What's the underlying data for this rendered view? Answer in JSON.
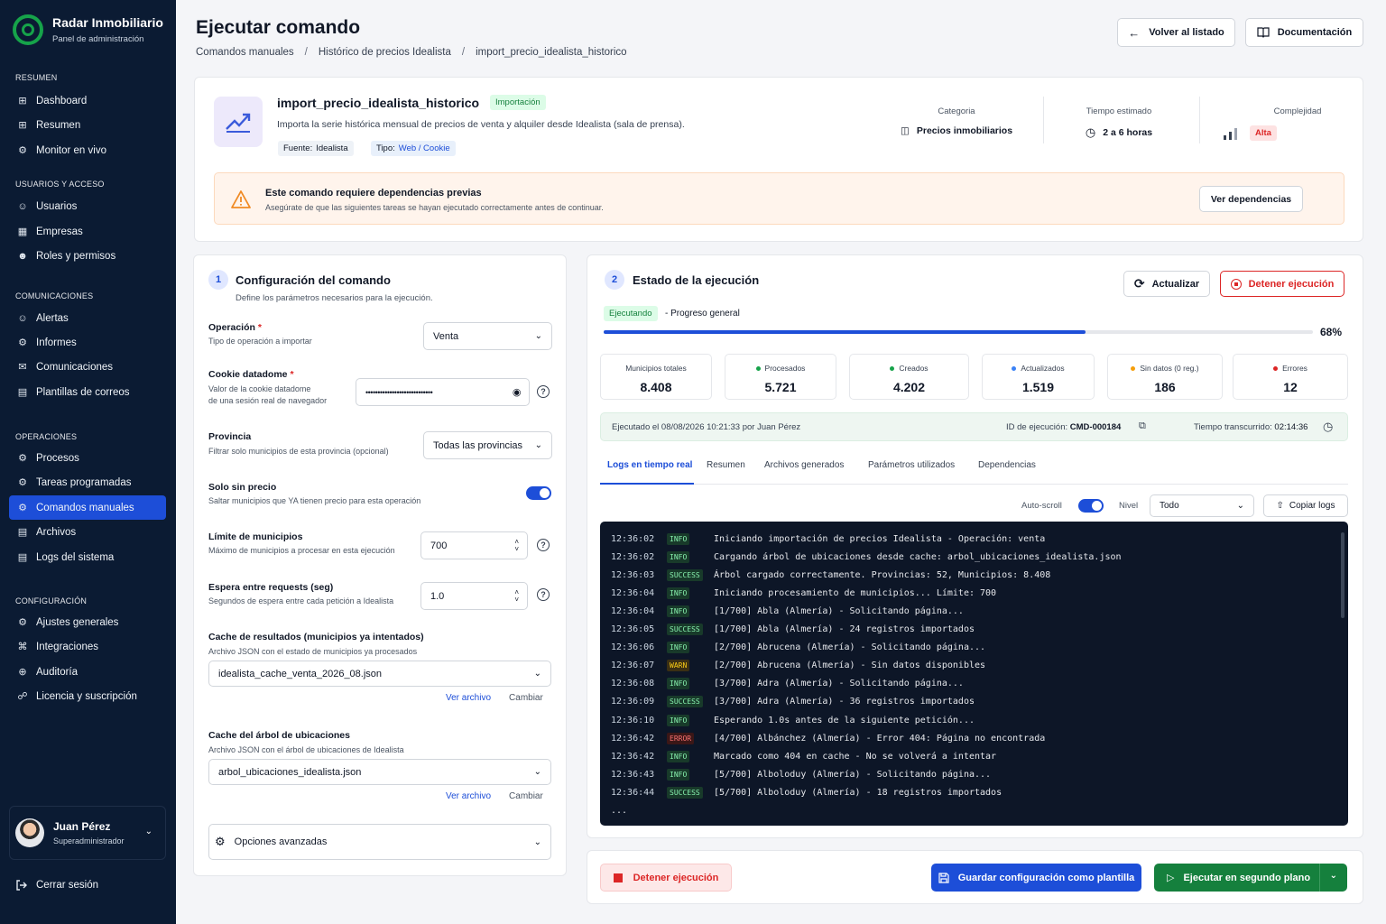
{
  "brand": {
    "title": "Radar Inmobiliario",
    "subtitle": "Panel de administración"
  },
  "nav": {
    "sections": [
      {
        "label": "RESUMEN",
        "items": [
          {
            "label": "Dashboard",
            "icon": "grid-icon"
          },
          {
            "label": "Resumen",
            "icon": "grid-icon"
          },
          {
            "label": "Monitor en vivo",
            "icon": "gear-icon"
          }
        ]
      },
      {
        "label": "USUARIOS Y ACCESO",
        "items": [
          {
            "label": "Usuarios",
            "icon": "user-icon"
          },
          {
            "label": "Empresas",
            "icon": "building-icon"
          },
          {
            "label": "Roles y permisos",
            "icon": "users-icon"
          }
        ]
      },
      {
        "label": "COMUNICACIONES",
        "items": [
          {
            "label": "Alertas",
            "icon": "user-icon"
          },
          {
            "label": "Informes",
            "icon": "gear-icon"
          },
          {
            "label": "Comunicaciones",
            "icon": "chat-icon"
          },
          {
            "label": "Plantillas de correos",
            "icon": "document-icon"
          }
        ]
      },
      {
        "label": "OPERACIONES",
        "items": [
          {
            "label": "Procesos",
            "icon": "gear-icon"
          },
          {
            "label": "Tareas programadas",
            "icon": "gear-icon"
          },
          {
            "label": "Comandos manuales",
            "icon": "gear-icon",
            "active": true
          },
          {
            "label": "Archivos",
            "icon": "document-icon"
          },
          {
            "label": "Logs del sistema",
            "icon": "document-icon"
          }
        ]
      },
      {
        "label": "CONFIGURACIÓN",
        "items": [
          {
            "label": "Ajustes generales",
            "icon": "gear-icon"
          },
          {
            "label": "Integraciones",
            "icon": "command-icon"
          },
          {
            "label": "Auditoría",
            "icon": "plus-circle-icon"
          },
          {
            "label": "Licencia y suscripción",
            "icon": "link-icon"
          }
        ]
      }
    ]
  },
  "user": {
    "name": "Juan Pérez",
    "role": "Superadministrador",
    "logout": "Cerrar sesión"
  },
  "header": {
    "title": "Ejecutar comando",
    "breadcrumb": [
      "Comandos manuales",
      "Histórico de precios Idealista",
      "import_precio_idealista_historico"
    ],
    "back": "Volver al listado",
    "docs": "Documentación"
  },
  "command": {
    "name": "import_precio_idealista_historico",
    "badge": "Importación",
    "description": "Importa la serie histórica mensual de precios de venta y alquiler desde Idealista (sala de prensa).",
    "source_label": "Fuente:",
    "source_value": "Idealista",
    "type_label": "Tipo:",
    "type_value": "Web / Cookie",
    "category_label": "Categoria",
    "category_value": "Precios inmobiliarios",
    "time_label": "Tiempo estimado",
    "time_value": "2 a 6 horas",
    "complexity_label": "Complejidad",
    "complexity_value": "Alta"
  },
  "alert": {
    "title": "Este comando requiere dependencias previas",
    "text": "Asegúrate de que las siguientes tareas se hayan ejecutado correctamente antes de continuar.",
    "button": "Ver dependencias"
  },
  "config": {
    "number": "1",
    "title": "Configuración del comando",
    "subtitle": "Define los parámetros necesarios para la ejecución.",
    "operation": {
      "label": "Operación",
      "help": "Tipo de operación a importar",
      "value": "Venta"
    },
    "cookie": {
      "label": "Cookie datadome",
      "help1": "Valor de la cookie datadome",
      "help2": "de una sesión real de navegador",
      "value": "••••••••••••••••••••••••••••"
    },
    "province": {
      "label": "Provincia",
      "help": "Filtrar solo municipios de esta provincia (opcional)",
      "value": "Todas las provincias"
    },
    "noprice": {
      "label": "Solo sin precio",
      "help": "Saltar municipios que YA tienen precio para esta operación"
    },
    "limit": {
      "label": "Límite de municipios",
      "help": "Máximo de municipios a procesar en esta ejecución",
      "value": "700"
    },
    "wait": {
      "label": "Espera entre requests (seg)",
      "help": "Segundos de espera entre cada petición a Idealista",
      "value": "1.0"
    },
    "cache": {
      "label": "Cache de resultados (municipios ya intentados)",
      "help": "Archivo JSON con el estado de municipios ya procesados",
      "value": "idealista_cache_venta_2026_08.json",
      "view": "Ver archivo",
      "change": "Cambiar"
    },
    "tree": {
      "label": "Cache del árbol de ubicaciones",
      "help": "Archivo JSON con el árbol de ubicaciones de Idealista",
      "value": "arbol_ubicaciones_idealista.json",
      "view": "Ver archivo",
      "change": "Cambiar"
    },
    "advanced": "Opciones avanzadas"
  },
  "status": {
    "number": "2",
    "title": "Estado de la ejecución",
    "refresh": "Actualizar",
    "stop": "Detener ejecución",
    "state": "Ejecutando",
    "progress_label": "Progreso general",
    "progress": 0.68,
    "progress_text": "68%",
    "stats": [
      {
        "label": "Municipios totales",
        "value": "8.408",
        "dot": ""
      },
      {
        "label": "Procesados",
        "value": "5.721",
        "dot": "#16a34a"
      },
      {
        "label": "Creados",
        "value": "4.202",
        "dot": "#16a34a"
      },
      {
        "label": "Actualizados",
        "value": "1.519",
        "dot": "#3b82f6"
      },
      {
        "label": "Sin datos (0 reg.)",
        "value": "186",
        "dot": "#f59e0b"
      },
      {
        "label": "Errores",
        "value": "12",
        "dot": "#dc2626"
      }
    ],
    "executed": "Ejecutado el 08/08/2026 10:21:33 por Juan Pérez",
    "exec_id_label": "ID de ejecución:",
    "exec_id": "CMD-000184",
    "elapsed_label": "Tiempo transcurrido:",
    "elapsed": "02:14:36",
    "tabs": [
      "Logs en tiempo real",
      "Resumen",
      "Archivos generados",
      "Parámetros utilizados",
      "Dependencias"
    ],
    "autoscroll": "Auto-scroll",
    "level_label": "Nivel",
    "level_value": "Todo",
    "copy": "Copiar logs",
    "logs": [
      {
        "t": "12:36:02",
        "l": "INFO",
        "m": "Iniciando importación de precios Idealista - Operación: venta"
      },
      {
        "t": "12:36:02",
        "l": "INFO",
        "m": "Cargando árbol de ubicaciones desde cache: arbol_ubicaciones_idealista.json"
      },
      {
        "t": "12:36:03",
        "l": "SUCCESS",
        "m": "Árbol cargado correctamente. Provincias: 52, Municipios: 8.408"
      },
      {
        "t": "12:36:04",
        "l": "INFO",
        "m": "Iniciando procesamiento de municipios... Límite: 700"
      },
      {
        "t": "12:36:04",
        "l": "INFO",
        "m": "[1/700] Abla (Almería) - Solicitando página..."
      },
      {
        "t": "12:36:05",
        "l": "SUCCESS",
        "m": "[1/700] Abla (Almería) - 24 registros importados"
      },
      {
        "t": "12:36:06",
        "l": "INFO",
        "m": "[2/700] Abrucena (Almería) - Solicitando página..."
      },
      {
        "t": "12:36:07",
        "l": "WARN",
        "m": "[2/700] Abrucena (Almería) - Sin datos disponibles"
      },
      {
        "t": "12:36:08",
        "l": "INFO",
        "m": "[3/700] Adra (Almería) - Solicitando página..."
      },
      {
        "t": "12:36:09",
        "l": "SUCCESS",
        "m": "[3/700] Adra (Almería) - 36 registros importados"
      },
      {
        "t": "12:36:10",
        "l": "INFO",
        "m": "Esperando 1.0s antes de la siguiente petición..."
      },
      {
        "t": "12:36:42",
        "l": "ERROR",
        "m": "[4/700] Albánchez (Almería) - Error 404: Página no encontrada"
      },
      {
        "t": "12:36:42",
        "l": "INFO",
        "m": "Marcado como 404 en cache - No se volverá a intentar"
      },
      {
        "t": "12:36:43",
        "l": "INFO",
        "m": "[5/700] Alboloduy (Almería) - Solicitando página..."
      },
      {
        "t": "12:36:44",
        "l": "SUCCESS",
        "m": "[5/700] Alboloduy (Almería) - 18 registros importados"
      }
    ],
    "ellipsis": "...",
    "footer_stop": "Detener ejecución",
    "save_template": "Guardar configuración como plantilla",
    "run_bg": "Ejecutar en segundo plano"
  }
}
